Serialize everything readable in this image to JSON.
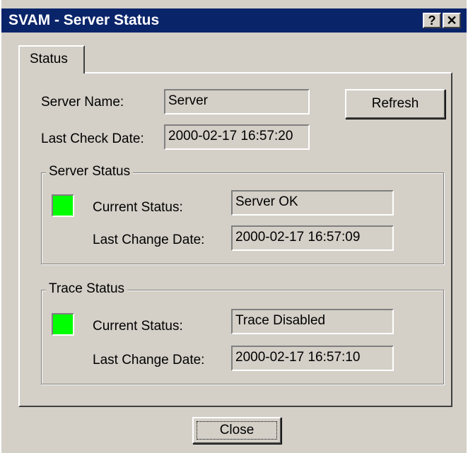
{
  "window": {
    "title": "SVAM - Server Status",
    "help_glyph": "?",
    "close_glyph": "✕"
  },
  "tabs": [
    {
      "label": "Status"
    }
  ],
  "server": {
    "name_label": "Server Name:",
    "name_value": "Server",
    "last_check_label": "Last Check Date:",
    "last_check_value": "2000-02-17 16:57:20",
    "refresh_label": "Refresh"
  },
  "server_status": {
    "group_label": "Server Status",
    "indicator_color": "#00ff00",
    "current_label": "Current Status:",
    "current_value": "Server OK",
    "last_change_label": "Last Change Date:",
    "last_change_value": "2000-02-17 16:57:09"
  },
  "trace_status": {
    "group_label": "Trace Status",
    "indicator_color": "#00ff00",
    "current_label": "Current Status:",
    "current_value": "Trace Disabled",
    "last_change_label": "Last Change Date:",
    "last_change_value": "2000-02-17 16:57:10"
  },
  "footer": {
    "close_label": "Close"
  }
}
